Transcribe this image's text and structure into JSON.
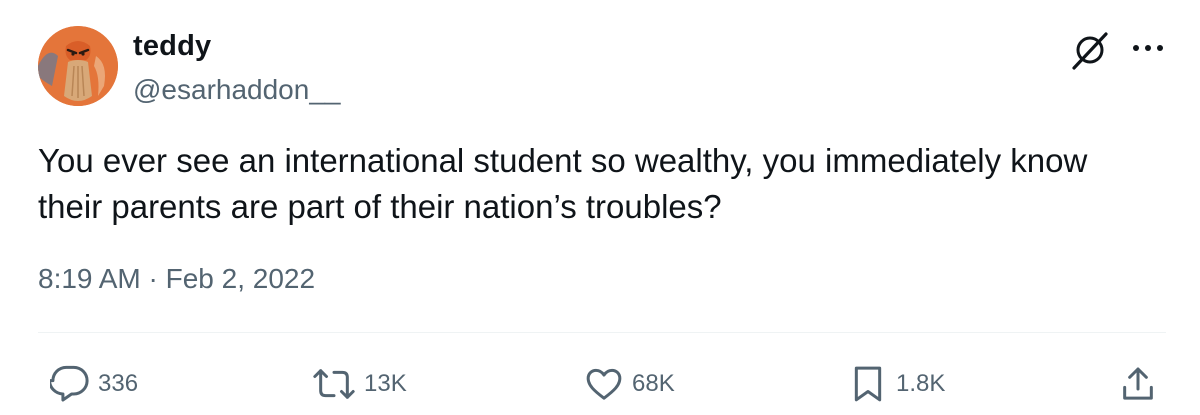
{
  "tweet": {
    "author": {
      "display_name": "teddy",
      "handle": "@esarhaddon__"
    },
    "text_line1": "You ever see an international student so wealthy, you immediately know",
    "text_line2": "their parents are part of their nation’s troubles?",
    "timestamp": "8:19 AM · Feb 2, 2022",
    "icons": {
      "top_right": [
        "grok-icon",
        "more-icon"
      ],
      "actions": [
        "reply-icon",
        "retweet-icon",
        "like-icon",
        "bookmark-icon",
        "share-icon"
      ]
    },
    "actions": {
      "replies": "336",
      "retweets": "13K",
      "likes": "68K",
      "bookmarks": "1.8K"
    }
  },
  "colors": {
    "text_primary": "#0f1419",
    "text_secondary": "#536471",
    "divider": "#eff3f4",
    "avatar_bg": "#e4753a"
  }
}
